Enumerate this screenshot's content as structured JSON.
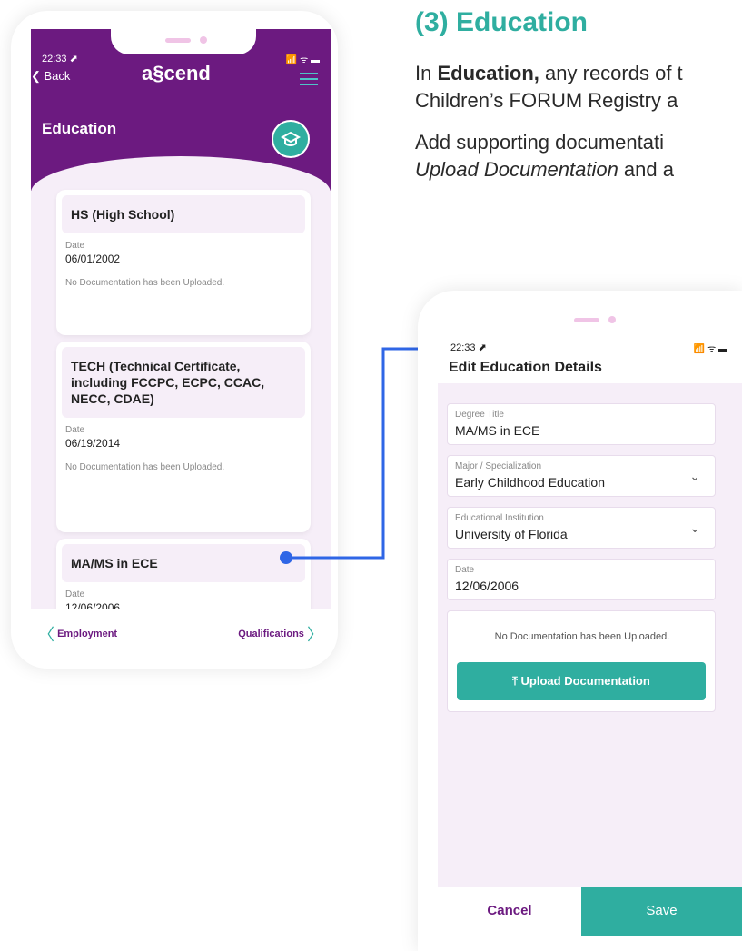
{
  "section": {
    "heading": "(3)  Education",
    "para1_prefix": "In ",
    "para1_bold": "Education,",
    "para1_rest": " any records of t",
    "para1_line2": "Children’s FORUM Registry a",
    "para2_line1": "Add supporting documentati",
    "para2_italic": "Upload Documentation",
    "para2_rest": " and a"
  },
  "left_phone": {
    "status_time": "22:33 ⬈",
    "status_icons": "📶 ᯤ ▬",
    "back_label": "Back",
    "logo": "a§cend",
    "screen_title": "Education",
    "cards": [
      {
        "title": "HS (High School)",
        "date_label": "Date",
        "date": "06/01/2002",
        "doc_status": "No Documentation has been Uploaded."
      },
      {
        "title": "TECH (Technical Certificate, including FCCPC, ECPC, CCAC, NECC, CDAE)",
        "date_label": "Date",
        "date": "06/19/2014",
        "doc_status": "No Documentation has been Uploaded."
      },
      {
        "title": "MA/MS in ECE",
        "date_label": "Date",
        "date": "12/06/2006"
      }
    ],
    "nav_prev": "Employment",
    "nav_next": "Qualifications"
  },
  "right_phone": {
    "status_time": "22:33 ⬈",
    "status_icons": "📶 ᯤ ▬",
    "title": "Edit Education Details",
    "fields": [
      {
        "label": "Degree Title",
        "value": "MA/MS in ECE"
      },
      {
        "label": "Major / Specialization",
        "value": "Early Childhood Education"
      },
      {
        "label": "Educational Institution",
        "value": "University of Florida"
      },
      {
        "label": "Date",
        "value": "12/06/2006"
      }
    ],
    "doc_status": "No Documentation has been Uploaded.",
    "upload_label": "Upload Documentation",
    "cancel_label": "Cancel",
    "save_label": "Save"
  },
  "colors": {
    "brand_purple": "#6c1a80",
    "accent_teal": "#2faea0",
    "connector_blue": "#2f66e6",
    "panel_bg": "#f6eef8"
  }
}
